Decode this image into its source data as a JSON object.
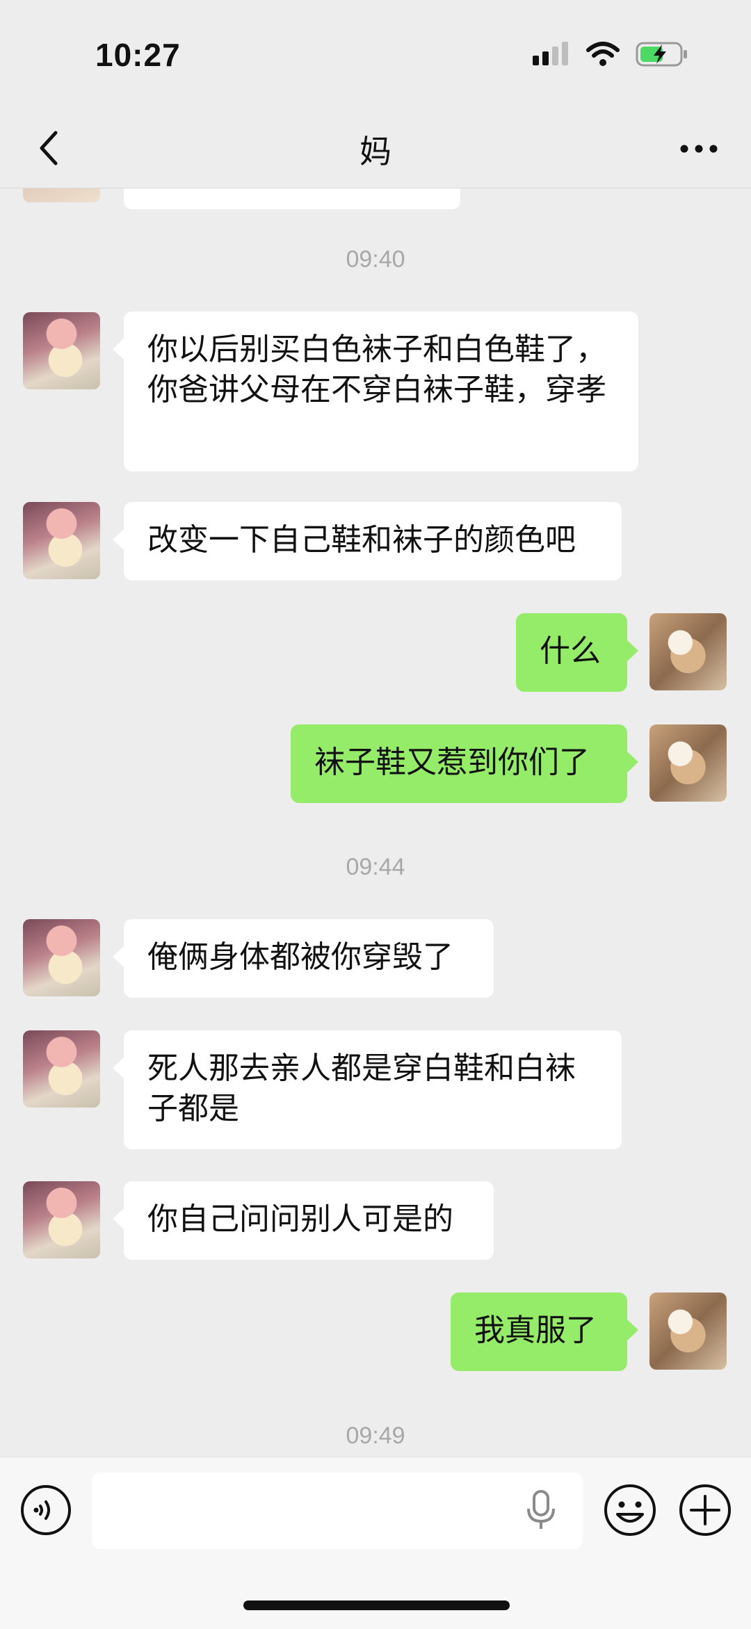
{
  "status_bar": {
    "time": "10:27",
    "icons": [
      "signal-icon",
      "wifi-icon",
      "battery-charging-icon"
    ],
    "battery_color": "#4cd964"
  },
  "nav": {
    "title": "妈",
    "back_icon": "chevron-left-icon",
    "more_icon": "more-dots-icon"
  },
  "colors": {
    "background": "#ededed",
    "incoming_bubble": "#ffffff",
    "outgoing_bubble": "#95ec69",
    "timestamp": "#a8a8a8"
  },
  "chat": {
    "timestamps": [
      "09:40",
      "09:44",
      "09:49"
    ],
    "messages": [
      {
        "from": "mom",
        "text": "你以后别买白色袜子和白色鞋了，你爸讲父母在不穿白袜子鞋，穿孝"
      },
      {
        "from": "mom",
        "text": "改变一下自己鞋和袜子的颜色吧"
      },
      {
        "from": "me",
        "text": "什么"
      },
      {
        "from": "me",
        "text": "袜子鞋又惹到你们了"
      },
      {
        "from": "mom",
        "text": "俺俩身体都被你穿毁了"
      },
      {
        "from": "mom",
        "text": "死人那去亲人都是穿白鞋和白袜子都是"
      },
      {
        "from": "mom",
        "text": "你自己问问别人可是的"
      },
      {
        "from": "me",
        "text": "我真服了"
      }
    ]
  },
  "input_bar": {
    "value": "",
    "placeholder": "",
    "icons": [
      "voice-icon",
      "microphone-icon",
      "emoji-icon",
      "plus-icon"
    ]
  }
}
